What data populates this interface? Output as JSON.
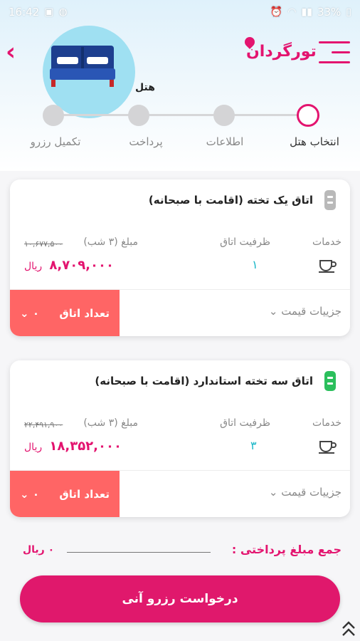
{
  "status_bar": {
    "time": "16:42",
    "battery": "33%"
  },
  "header": {
    "logo_text": "تورگردان",
    "hotel_label": "هتل"
  },
  "stepper": {
    "steps": [
      "انتخاب هتل",
      "اطلاعات",
      "پرداخت",
      "تکمیل رزرو"
    ],
    "active_index": 0
  },
  "columns": {
    "services": "خدمات",
    "capacity": "ظرفیت اتاق",
    "amount": "مبلغ (۳ شب)"
  },
  "rooms": [
    {
      "title": "اتاق یک تخته (اقامت با صبحانه)",
      "capacity": "۱",
      "old_price": "۱۰,۶۷۷,۵۰۰",
      "new_price": "۸,۷۰۹,۰۰۰",
      "currency": "ریال",
      "qty_label": "تعداد اتاق",
      "qty_value": "۰",
      "details_label": "جزییات قیمت",
      "icon_color": "#b9b9b9"
    },
    {
      "title": "اتاق سه تخته استاندارد (اقامت با صبحانه)",
      "capacity": "۳",
      "old_price": "۲۲,۴۹۱,۹۰۰",
      "new_price": "۱۸,۳۵۲,۰۰۰",
      "currency": "ریال",
      "qty_label": "تعداد اتاق",
      "qty_value": "۰",
      "details_label": "جزییات قیمت",
      "icon_color": "#2bbf5c"
    }
  ],
  "total": {
    "label": "جمع مبلغ پرداختی :",
    "value": "۰ ریال"
  },
  "reserve_button": "درخواست رزرو آنی",
  "colors": {
    "brand": "#e3146f",
    "qty_button": "#ff6565",
    "capacity": "#19b7c8"
  }
}
